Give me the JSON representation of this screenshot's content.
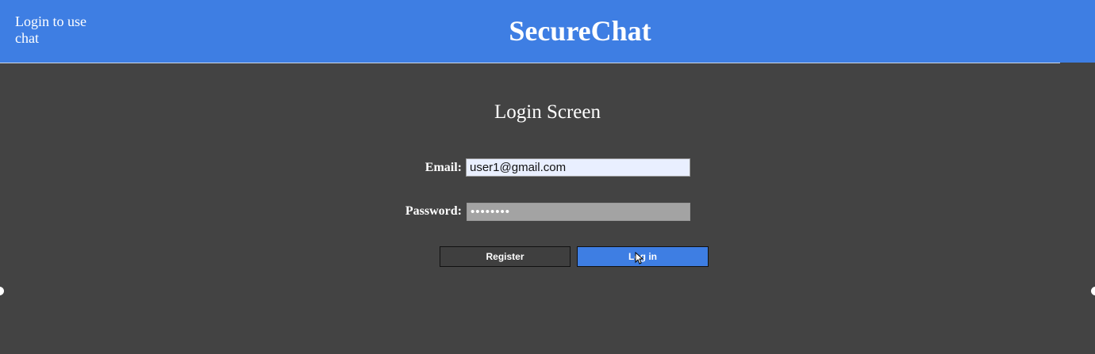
{
  "header": {
    "note": "Login to use chat",
    "brand": "SecureChat",
    "background_color": "#3e7ee3"
  },
  "login": {
    "title": "Login Screen",
    "email_label": "Email:",
    "email_value": "user1@gmail.com",
    "password_label": "Password:",
    "password_value": "password",
    "register_label": "Register",
    "login_label": "Log in"
  },
  "colors": {
    "page_background": "#434343",
    "accent": "#3e7ee3",
    "email_field": "#e9efff",
    "password_field": "#a3a3a3"
  },
  "icons": {
    "cursor": "mouse-pointer-icon"
  }
}
